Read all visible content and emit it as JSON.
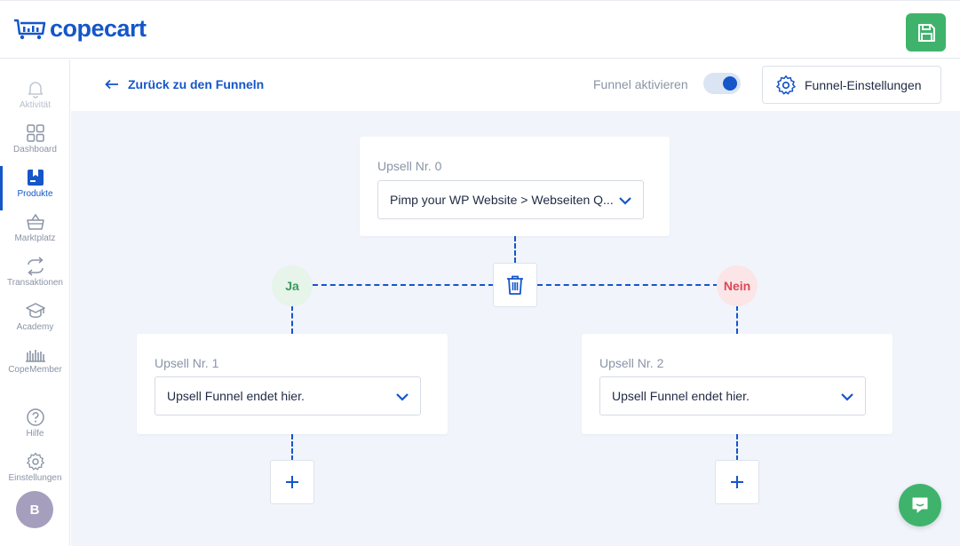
{
  "app": {
    "logo_text": "copecart",
    "brand_color": "#1556c9",
    "accent_green": "#3fb36b"
  },
  "topbar": {
    "save_icon": "floppy-disk-icon"
  },
  "sidebar": {
    "items": [
      {
        "label": "Aktivität",
        "icon": "bell-icon"
      },
      {
        "label": "Dashboard",
        "icon": "grid-icon"
      },
      {
        "label": "Produkte",
        "icon": "product-box-icon",
        "active": true
      },
      {
        "label": "Marktplatz",
        "icon": "basket-icon"
      },
      {
        "label": "Transaktionen",
        "icon": "exchange-icon"
      },
      {
        "label": "Academy",
        "icon": "graduation-cap-icon"
      },
      {
        "label": "CopeMember",
        "icon": "library-icon"
      },
      {
        "label": "Hilfe",
        "icon": "question-circle-icon"
      },
      {
        "label": "Einstellungen",
        "icon": "gear-icon"
      }
    ],
    "avatar_initial": "B"
  },
  "header": {
    "back_label": "Zurück zu den Funneln",
    "toggle_label": "Funnel aktivieren",
    "toggle_on": true,
    "settings_label": "Funnel-Einstellungen"
  },
  "funnel": {
    "root": {
      "title": "Upsell Nr. 0",
      "selected": "Pimp your WP Website > Webseiten Q..."
    },
    "yes_label": "Ja",
    "no_label": "Nein",
    "left": {
      "title": "Upsell Nr. 1",
      "selected": "Upsell Funnel endet hier."
    },
    "right": {
      "title": "Upsell Nr. 2",
      "selected": "Upsell Funnel endet hier."
    }
  }
}
